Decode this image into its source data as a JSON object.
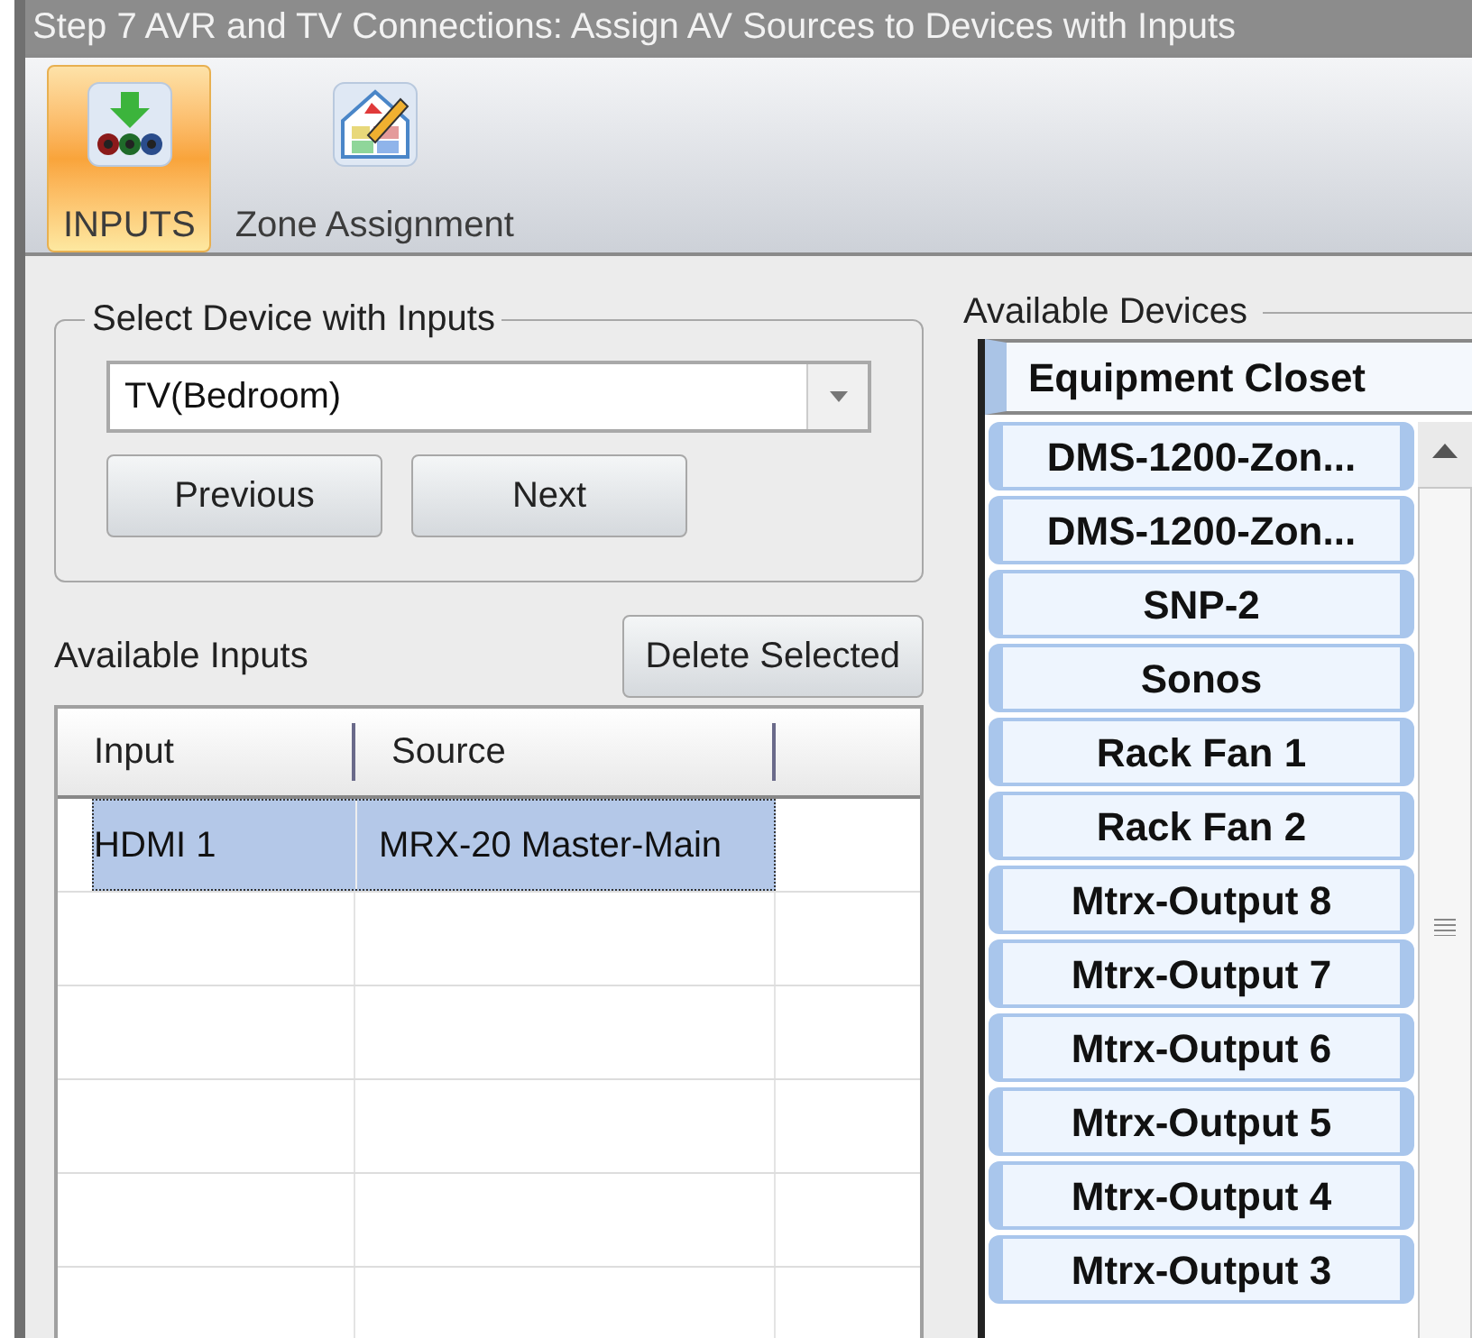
{
  "window": {
    "title": "Step 7 AVR and TV Connections: Assign AV Sources to Devices with Inputs"
  },
  "ribbon": {
    "buttons": [
      {
        "label": "INPUTS",
        "kind": "inputs",
        "selected": true
      },
      {
        "label": "Zone Assignment",
        "kind": "zones",
        "selected": false
      }
    ]
  },
  "device_group": {
    "title": "Select Device with Inputs",
    "device_select": {
      "value": "TV(Bedroom)"
    },
    "buttons": [
      "Previous",
      "Next"
    ]
  },
  "inputs": {
    "label": "Available Inputs",
    "delete_button": "Delete Selected",
    "columns": [
      "Input",
      "Source"
    ],
    "rows": [
      {
        "input": "HDMI 1",
        "source": "MRX-20 Master-Main",
        "selected": true
      }
    ]
  },
  "devices": {
    "title": "Available Devices",
    "tab": "Equipment Closet",
    "items": [
      "DMS-1200-Zon...",
      "DMS-1200-Zon...",
      "SNP-2",
      "Sonos",
      "Rack Fan 1",
      "Rack Fan 2",
      "Mtrx-Output 8",
      "Mtrx-Output 7",
      "Mtrx-Output 6",
      "Mtrx-Output 5",
      "Mtrx-Output 4",
      "Mtrx-Output 3"
    ]
  }
}
